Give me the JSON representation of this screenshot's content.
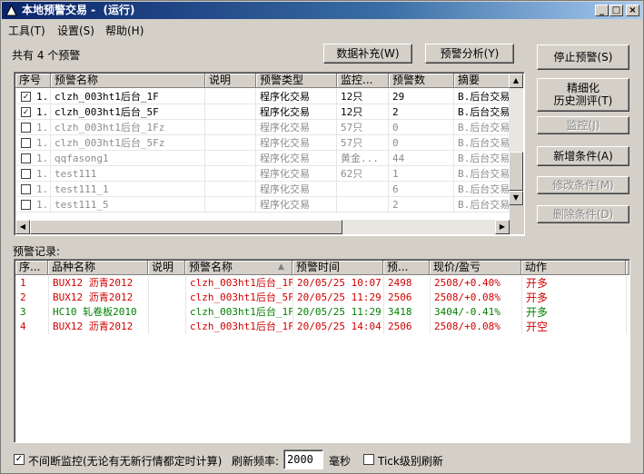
{
  "window": {
    "title": "本地预警交易 -  (运行)",
    "minimize": "_",
    "maximize": "□",
    "close": "×"
  },
  "menu": [
    "工具(T)",
    "设置(S)",
    "帮助(H)"
  ],
  "summary": "共有 4 个预警",
  "buttons": {
    "data_fill": "数据补充(W)",
    "alert_analysis": "预警分析(Y)",
    "stop_alert": "停止预警(S)",
    "refine_line1": "精细化",
    "refine_line2": "历史测评(T)",
    "monitor": "监控(J)",
    "add_condition": "新增条件(A)",
    "edit_condition": "修改条件(M)",
    "delete_condition": "删除条件(D)"
  },
  "alerts_table": {
    "headers": [
      "序号",
      "预警名称",
      "说明",
      "预警类型",
      "监控...",
      "预警数",
      "摘要"
    ],
    "rows": [
      {
        "idx": "1.",
        "checked": true,
        "name": "clzh_003ht1后台_1F",
        "desc": "",
        "type": "程序化交易",
        "monitor": "12只",
        "count": "29",
        "summary": "B.后台交易",
        "style": "normal"
      },
      {
        "idx": "1.",
        "checked": true,
        "name": "clzh_003ht1后台_5F",
        "desc": "",
        "type": "程序化交易",
        "monitor": "12只",
        "count": "2",
        "summary": "B.后台交易",
        "style": "normal"
      },
      {
        "idx": "1.",
        "checked": false,
        "name": "clzh_003ht1后台_1Fz",
        "desc": "",
        "type": "程序化交易",
        "monitor": "57只",
        "count": "0",
        "summary": "B.后台交易",
        "style": "gray"
      },
      {
        "idx": "1.",
        "checked": false,
        "name": "clzh_003ht1后台_5Fz",
        "desc": "",
        "type": "程序化交易",
        "monitor": "57只",
        "count": "0",
        "summary": "B.后台交易",
        "style": "gray"
      },
      {
        "idx": "1.",
        "checked": false,
        "name": "qqfasong1",
        "desc": "",
        "type": "程序化交易",
        "monitor": "黄金...",
        "count": "44",
        "summary": "B.后台交易",
        "style": "gray"
      },
      {
        "idx": "1.",
        "checked": false,
        "name": "test111",
        "desc": "",
        "type": "程序化交易",
        "monitor": "62只",
        "count": "1",
        "summary": "B.后台交易",
        "style": "gray"
      },
      {
        "idx": "1.",
        "checked": false,
        "name": "test111_1",
        "desc": "",
        "type": "程序化交易",
        "monitor": "",
        "count": "6",
        "summary": "B.后台交易",
        "style": "gray"
      },
      {
        "idx": "1.",
        "checked": false,
        "name": "test111_5",
        "desc": "",
        "type": "程序化交易",
        "monitor": "",
        "count": "2",
        "summary": "B.后台交易",
        "style": "gray"
      }
    ]
  },
  "records_label": "预警记录:",
  "records_table": {
    "headers": [
      "序...",
      "品种名称",
      "说明",
      "预警名称",
      "预警时间",
      "预...",
      "现价/盈亏",
      "动作"
    ],
    "rows": [
      {
        "idx": "1",
        "product": "BUX12 沥青2012",
        "desc": "",
        "alert": "clzh_003ht1后台_1F",
        "time": "20/05/25 10:07",
        "price": "2498",
        "pl": "2508/+0.40%",
        "action": "开多",
        "color": "red"
      },
      {
        "idx": "2",
        "product": "BUX12 沥青2012",
        "desc": "",
        "alert": "clzh_003ht1后台_5F",
        "time": "20/05/25 11:29",
        "price": "2506",
        "pl": "2508/+0.08%",
        "action": "开多",
        "color": "red"
      },
      {
        "idx": "3",
        "product": "HC10 轧卷板2010",
        "desc": "",
        "alert": "clzh_003ht1后台_1F",
        "time": "20/05/25 11:29",
        "price": "3418",
        "pl": "3404/-0.41%",
        "action": "开多",
        "color": "green"
      },
      {
        "idx": "4",
        "product": "BUX12 沥青2012",
        "desc": "",
        "alert": "clzh_003ht1后台_1F",
        "time": "20/05/25 14:04",
        "price": "2506",
        "pl": "2508/+0.08%",
        "action": "开空",
        "color": "red"
      }
    ]
  },
  "footer": {
    "continuous_monitor": "不间断监控(无论有无新行情都定时计算)",
    "refresh_label": "刷新频率:",
    "refresh_value": "2000",
    "unit": "毫秒",
    "tick_refresh": "Tick级别刷新",
    "continuous_checked": true,
    "tick_checked": false
  }
}
